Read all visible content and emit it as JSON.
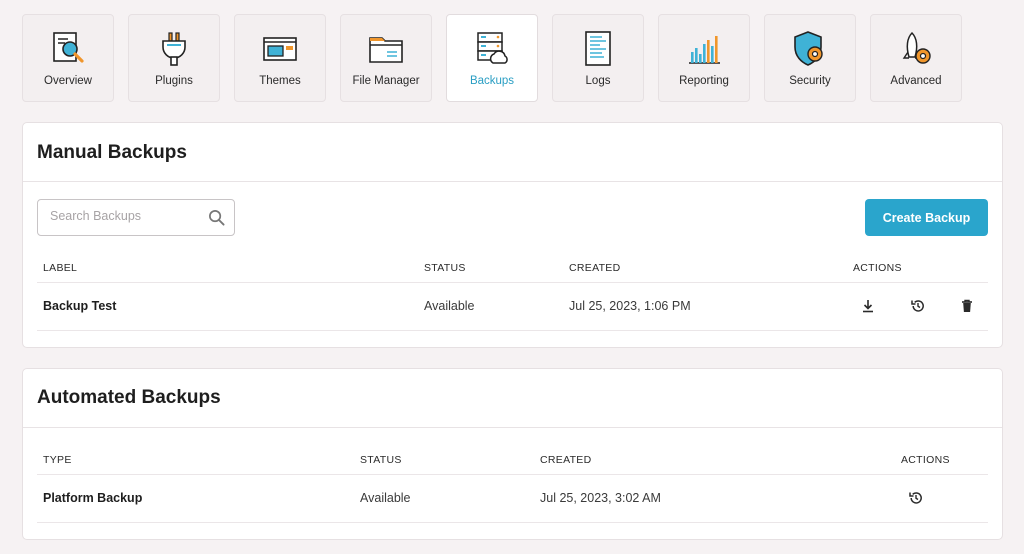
{
  "tabs": [
    {
      "label": "Overview",
      "icon": "overview-magnifier-icon"
    },
    {
      "label": "Plugins",
      "icon": "plug-icon"
    },
    {
      "label": "Themes",
      "icon": "browser-window-icon"
    },
    {
      "label": "File Manager",
      "icon": "folder-icon"
    },
    {
      "label": "Backups",
      "icon": "server-cloud-icon",
      "active": true
    },
    {
      "label": "Logs",
      "icon": "document-log-icon"
    },
    {
      "label": "Reporting",
      "icon": "bar-chart-icon"
    },
    {
      "label": "Security",
      "icon": "shield-gear-icon"
    },
    {
      "label": "Advanced",
      "icon": "rocket-gear-icon"
    }
  ],
  "manual": {
    "title": "Manual Backups",
    "search_placeholder": "Search Backups",
    "create_label": "Create Backup",
    "columns": {
      "label": "LABEL",
      "status": "STATUS",
      "created": "CREATED",
      "actions": "ACTIONS"
    },
    "rows": [
      {
        "label": "Backup Test",
        "status": "Available",
        "created": "Jul 25, 2023, 1:06 PM"
      }
    ]
  },
  "automated": {
    "title": "Automated Backups",
    "columns": {
      "type": "TYPE",
      "status": "STATUS",
      "created": "CREATED",
      "actions": "ACTIONS"
    },
    "rows": [
      {
        "type": "Platform Backup",
        "status": "Available",
        "created": "Jul 25, 2023, 3:02 AM"
      }
    ]
  },
  "colors": {
    "accent": "#2aa5cc",
    "orange": "#f0962c",
    "blue": "#2a9ec3"
  }
}
